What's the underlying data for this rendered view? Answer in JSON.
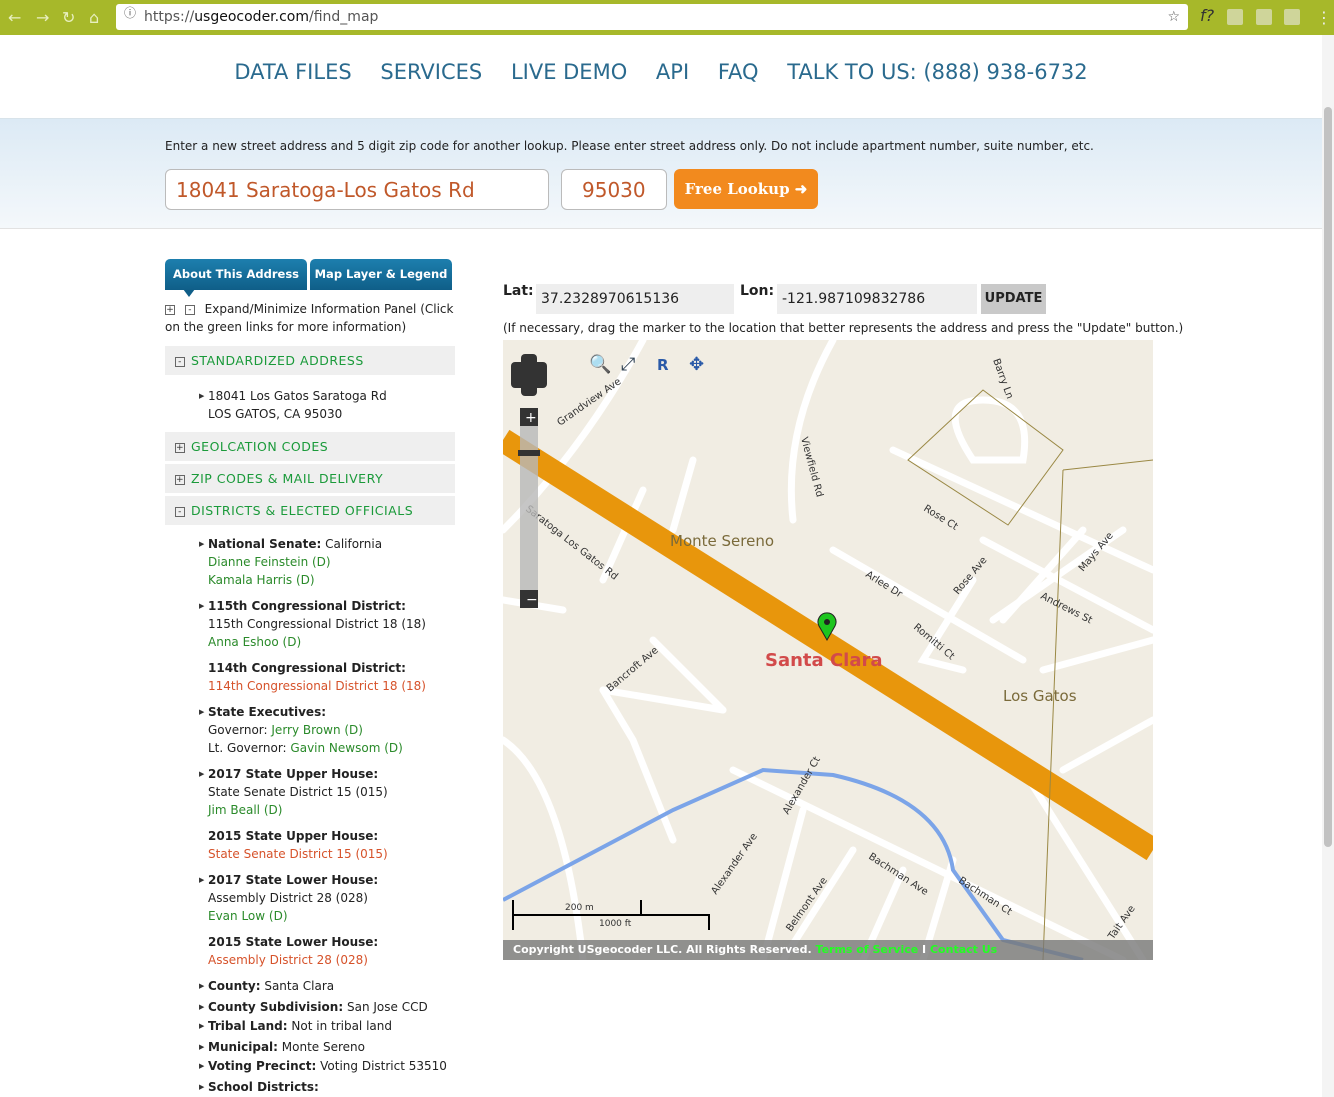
{
  "browser": {
    "url_scheme": "https://",
    "url_host": "usgeocoder.com",
    "url_path": "/find_map"
  },
  "nav": [
    "DATA FILES",
    "SERVICES",
    "LIVE DEMO",
    "API",
    "FAQ",
    "TALK TO US: (888) 938-6732"
  ],
  "search": {
    "hint": "Enter a new street address and 5 digit zip code for another lookup. Please enter street address only. Do not include apartment number, suite number, etc.",
    "address": "18041 Saratoga-Los Gatos Rd",
    "zip": "95030",
    "button": "Free Lookup"
  },
  "tabs": [
    "About This Address",
    "Map Layer & Legend"
  ],
  "expand_text": "Expand/Minimize Information Panel (Click on the green links for more information)",
  "sections": {
    "standardized": "STANDARDIZED ADDRESS",
    "geo": "GEOLCATION CODES",
    "zip": "ZIP CODES & MAIL DELIVERY",
    "districts": "DISTRICTS & ELECTED OFFICIALS"
  },
  "address": {
    "line1": "18041 Los Gatos Saratoga Rd",
    "line2": "LOS GATOS, CA 95030"
  },
  "districts": {
    "senate_label": "National Senate:",
    "senate_value": "California",
    "senator1": "Dianne Feinstein (D)",
    "senator2": "Kamala Harris (D)",
    "c115_label": "115th Congressional District:",
    "c115_value": "115th Congressional District 18 (18)",
    "c115_rep": "Anna Eshoo (D)",
    "c114_label": "114th Congressional District:",
    "c114_value": "114th Congressional District 18 (18)",
    "exec_label": "State Executives:",
    "gov_label": "Governor:",
    "gov": "Jerry Brown (D)",
    "ltgov_label": "Lt. Governor:",
    "ltgov": "Gavin Newsom (D)",
    "su17_label": "2017 State Upper House:",
    "su17_value": "State Senate District 15 (015)",
    "su17_rep": "Jim Beall (D)",
    "su15_label": "2015 State Upper House:",
    "su15_value": "State Senate District 15 (015)",
    "sl17_label": "2017 State Lower House:",
    "sl17_value": "Assembly District 28 (028)",
    "sl17_rep": "Evan Low (D)",
    "sl15_label": "2015 State Lower House:",
    "sl15_value": "Assembly District 28 (028)",
    "county_label": "County:",
    "county": "Santa Clara",
    "subdiv_label": "County Subdivision:",
    "subdiv": "San Jose CCD",
    "tribal_label": "Tribal Land:",
    "tribal": "Not in tribal land",
    "muni_label": "Municipal:",
    "muni": "Monte Sereno",
    "precinct_label": "Voting Precinct:",
    "precinct": "Voting District 53510",
    "school_label": "School Districts:"
  },
  "coords": {
    "lat_label": "Lat:",
    "lat": "37.2328970615136",
    "lon_label": "Lon:",
    "lon": "-121.987109832786",
    "update": "UPDATE",
    "drag_hint": "(If necessary, drag the marker to the location that better represents the address and press the \"Update\" button.)"
  },
  "map": {
    "places": [
      "Monte Sereno",
      "Santa Clara",
      "Los Gatos"
    ],
    "streets": [
      "Saratoga Los Gatos Rd",
      "Grandview Ave",
      "Viewfield Rd",
      "Barry Ln",
      "Rose Ct",
      "Arlee Dr",
      "Rose Ave",
      "Mays Ave",
      "Andrews St",
      "Romitti Ct",
      "Bancroft Ave",
      "Alexander Ct",
      "Alexander Ave",
      "Bachman Ave",
      "Bachman Ct",
      "Belmont Ave",
      "Tait Ave"
    ],
    "scale_m": "200 m",
    "scale_ft": "1000 ft",
    "copyright": "Copyright USgeocoder LLC. All Rights Reserved.",
    "terms": "Terms of Service",
    "sep": "I",
    "contact": "Contact Us",
    "colors": {
      "main_road": "#e8960c",
      "creek": "#7ba4e8",
      "background": "#f1ede3"
    }
  }
}
